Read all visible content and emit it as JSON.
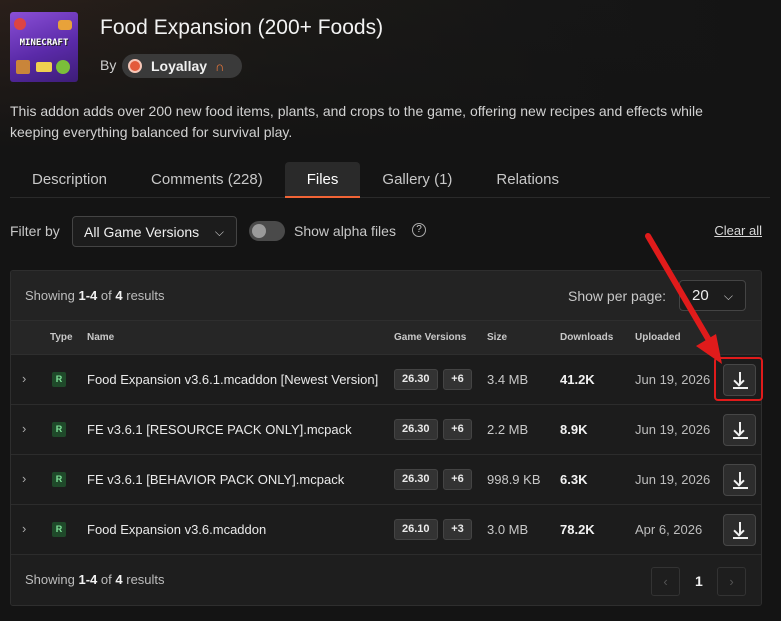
{
  "project": {
    "title": "Food Expansion (200+ Foods)",
    "by_label": "By",
    "author": "Loyallay",
    "description": "This addon adds over 200 new food items, plants, and crops to the game, offering new recipes and effects while keeping everything balanced for survival play.",
    "thumbnail_text": "MINECRAFT"
  },
  "tabs": [
    {
      "label": "Description"
    },
    {
      "label": "Comments (228)"
    },
    {
      "label": "Files",
      "active": true
    },
    {
      "label": "Gallery (1)"
    },
    {
      "label": "Relations"
    }
  ],
  "filters": {
    "filter_by_label": "Filter by",
    "version_select": "All Game Versions",
    "alpha_toggle_label": "Show alpha files",
    "alpha_toggle_on": false,
    "clear_all": "Clear all",
    "help_glyph": "?"
  },
  "results": {
    "showing_prefix": "Showing",
    "range": "1-4",
    "of": "of",
    "total": "4",
    "suffix": "results",
    "per_page_label": "Show per page:",
    "per_page_value": "20"
  },
  "columns": {
    "type": "Type",
    "name": "Name",
    "game_versions": "Game Versions",
    "size": "Size",
    "downloads": "Downloads",
    "uploaded": "Uploaded"
  },
  "files": [
    {
      "type": "R",
      "name": "Food Expansion v3.6.1.mcaddon [Newest Version]",
      "version": "26.30",
      "more": "+6",
      "size": "3.4 MB",
      "downloads": "41.2K",
      "uploaded": "Jun 19, 2026",
      "highlighted": true
    },
    {
      "type": "R",
      "name": "FE v3.6.1 [RESOURCE PACK ONLY].mcpack",
      "version": "26.30",
      "more": "+6",
      "size": "2.2 MB",
      "downloads": "8.9K",
      "uploaded": "Jun 19, 2026"
    },
    {
      "type": "R",
      "name": "FE v3.6.1 [BEHAVIOR PACK ONLY].mcpack",
      "version": "26.30",
      "more": "+6",
      "size": "998.9 KB",
      "downloads": "6.3K",
      "uploaded": "Jun 19, 2026"
    },
    {
      "type": "R",
      "name": "Food Expansion v3.6.mcaddon",
      "version": "26.10",
      "more": "+3",
      "size": "3.0 MB",
      "downloads": "78.2K",
      "uploaded": "Apr 6, 2026"
    }
  ],
  "pagination": {
    "current_page": "1",
    "prev_glyph": "‹",
    "next_glyph": "›"
  },
  "icons": {
    "expand": "›",
    "chevron_down": "⌵",
    "author_badge": "∩"
  },
  "colors": {
    "accent": "#f16436",
    "highlight": "#e01b1b",
    "release_badge": "#7fe39a"
  }
}
